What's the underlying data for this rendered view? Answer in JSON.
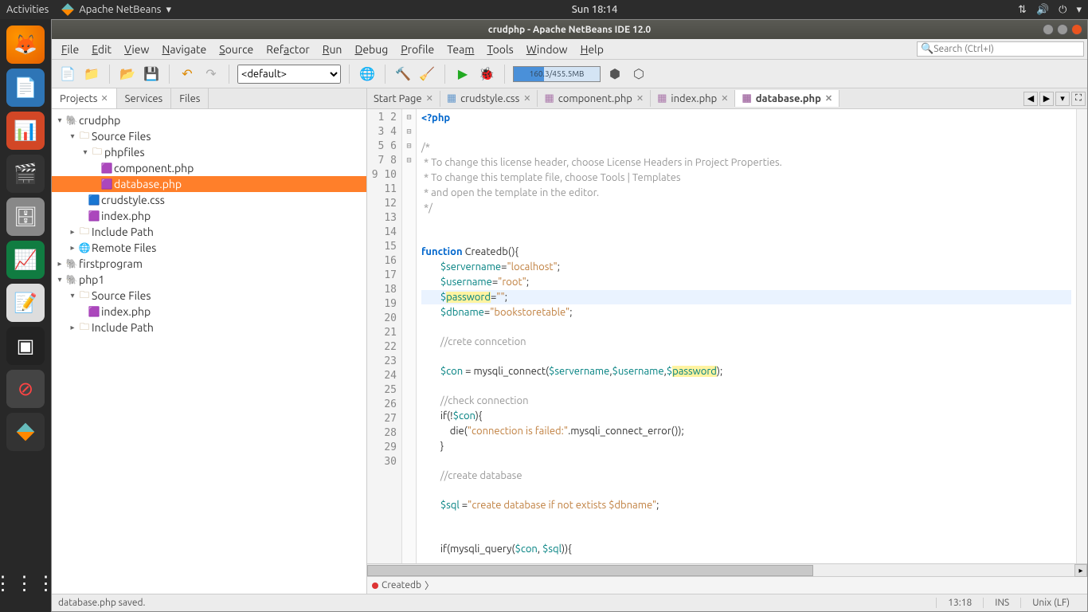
{
  "gnome": {
    "activities": "Activities",
    "app_name": "Apache NetBeans",
    "clock": "Sun 18:14"
  },
  "titlebar": "crudphp - Apache NetBeans IDE 12.0",
  "menus": [
    "File",
    "Edit",
    "View",
    "Navigate",
    "Source",
    "Refactor",
    "Run",
    "Debug",
    "Profile",
    "Team",
    "Tools",
    "Window",
    "Help"
  ],
  "search_placeholder": "Search (Ctrl+I)",
  "toolbar": {
    "config": "<default>",
    "memory": "160.3/455.5MB"
  },
  "sidetabs": {
    "projects": "Projects",
    "services": "Services",
    "files": "Files"
  },
  "tree": {
    "p1": "crudphp",
    "p1_src": "Source Files",
    "p1_phpfiles": "phpfiles",
    "p1_component": "component.php",
    "p1_database": "database.php",
    "p1_crudstyle": "crudstyle.css",
    "p1_index": "index.php",
    "p1_include": "Include Path",
    "p1_remote": "Remote Files",
    "p2": "firstprogram",
    "p3": "php1",
    "p3_src": "Source Files",
    "p3_index": "index.php",
    "p3_include": "Include Path"
  },
  "edtabs": {
    "start": "Start Page",
    "css": "crudstyle.css",
    "comp": "component.php",
    "index": "index.php",
    "db": "database.php"
  },
  "code": {
    "l1": "<?php",
    "l3": "/*",
    "l4": " * To change this license header, choose License Headers in Project Properties.",
    "l5": " * To change this template file, choose Tools | Templates",
    "l6": " * and open the template in the editor.",
    "l7": " */",
    "l10_a": "function",
    "l10_b": " Createdb(){",
    "l11_a": "        $servername",
    "l11_b": "=",
    "l11_c": "\"localhost\"",
    "l11_d": ";",
    "l12_a": "        $username",
    "l12_b": "=",
    "l12_c": "\"root\"",
    "l12_d": ";",
    "l13_a": "        $",
    "l13_p": "password",
    "l13_b": "=",
    "l13_c": "\"\"",
    "l13_d": ";",
    "l14_a": "        $dbname",
    "l14_b": "=",
    "l14_c": "\"bookstoretable\"",
    "l14_d": ";",
    "l16": "        //crete conncetion",
    "l18_a": "        $con",
    "l18_b": " = mysqli_connect(",
    "l18_c": "$servername",
    "l18_d": ",",
    "l18_e": "$username",
    "l18_f": ",",
    "l18_g": "$",
    "l18_h": "password",
    "l18_i": ");",
    "l20": "        //check connection",
    "l21_a": "        if(!",
    "l21_b": "$con",
    "l21_c": "){",
    "l22_a": "            die(",
    "l22_b": "\"connection is failed:\"",
    "l22_c": ".mysqli_connect_error());",
    "l23": "        }",
    "l25": "        //create database",
    "l27_a": "        $sql",
    "l27_b": " =",
    "l27_c": "\"create database if not extists $dbname\"",
    "l27_d": ";",
    "l30_a": "        if(mysqli_query(",
    "l30_b": "$con",
    "l30_c": ", ",
    "l30_d": "$sql",
    "l30_e": ")){"
  },
  "breadcrumb": "Createdb",
  "status": {
    "msg": "database.php saved.",
    "pos": "13:18",
    "ins": "INS",
    "enc": "Unix (LF)"
  }
}
